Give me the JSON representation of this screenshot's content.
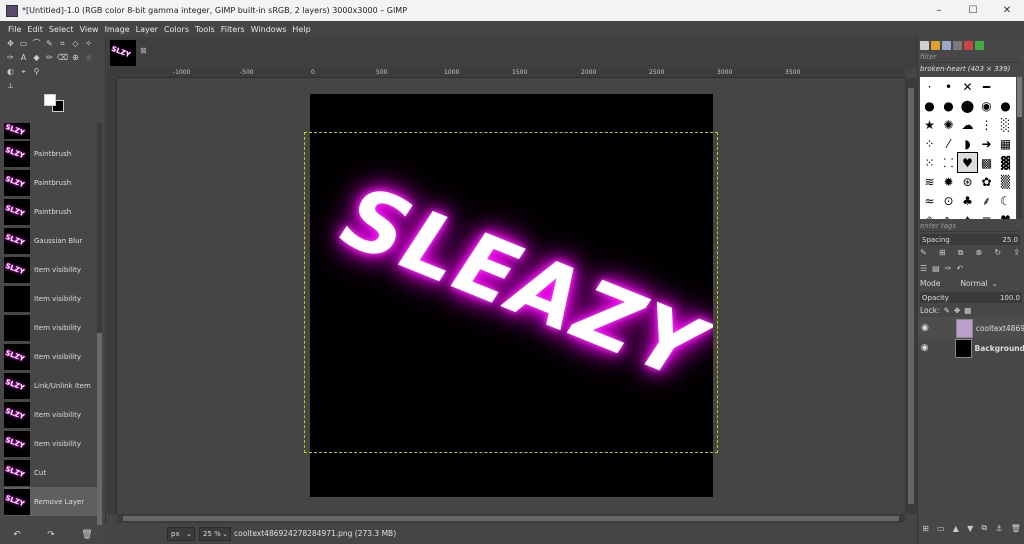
{
  "window": {
    "title": "*[Untitled]-1.0 (RGB color 8-bit gamma integer, GIMP built-in sRGB, 2 layers) 3000x3000 – GIMP",
    "minimize": "–",
    "maximize": "☐",
    "close": "✕"
  },
  "menu": [
    "File",
    "Edit",
    "Select",
    "View",
    "Image",
    "Layer",
    "Colors",
    "Tools",
    "Filters",
    "Windows",
    "Help"
  ],
  "undo_history": [
    {
      "label": "",
      "thumb": "pink"
    },
    {
      "label": "Paintbrush",
      "thumb": "pink"
    },
    {
      "label": "Paintbrush",
      "thumb": "pink"
    },
    {
      "label": "Paintbrush",
      "thumb": "pink"
    },
    {
      "label": "Gaussian Blur",
      "thumb": "pink"
    },
    {
      "label": "Item visibility",
      "thumb": "pink"
    },
    {
      "label": "Item visibility",
      "thumb": "black"
    },
    {
      "label": "Item visibility",
      "thumb": "black"
    },
    {
      "label": "Item visibility",
      "thumb": "pink"
    },
    {
      "label": "Link/Unlink Item",
      "thumb": "pink"
    },
    {
      "label": "Item visibility",
      "thumb": "pink"
    },
    {
      "label": "Item visibility",
      "thumb": "pink"
    },
    {
      "label": "Cut",
      "thumb": "pink"
    },
    {
      "label": "Remove Layer",
      "thumb": "pink"
    }
  ],
  "ruler_labels": [
    "-1000",
    "-500",
    "0",
    "500",
    "1000",
    "1500",
    "2000",
    "2500",
    "3000",
    "3500"
  ],
  "canvas_text": "SLEAZY",
  "status": {
    "unit": "px",
    "zoom": "25 %",
    "text": "cooltext486924278284971.png (273.3 MB)"
  },
  "brushes": {
    "filter_placeholder": "filter",
    "selected_name": "broken-heart (403 × 339)",
    "tags_placeholder": "enter tags",
    "spacing_label": "Spacing",
    "spacing_value": "25.0"
  },
  "layers": {
    "mode_label": "Mode",
    "mode_value": "Normal",
    "opacity_label": "Opacity",
    "opacity_value": "100.0",
    "lock_label": "Lock:",
    "items": [
      {
        "name": "cooltext4869"
      },
      {
        "name": "Background"
      }
    ]
  }
}
